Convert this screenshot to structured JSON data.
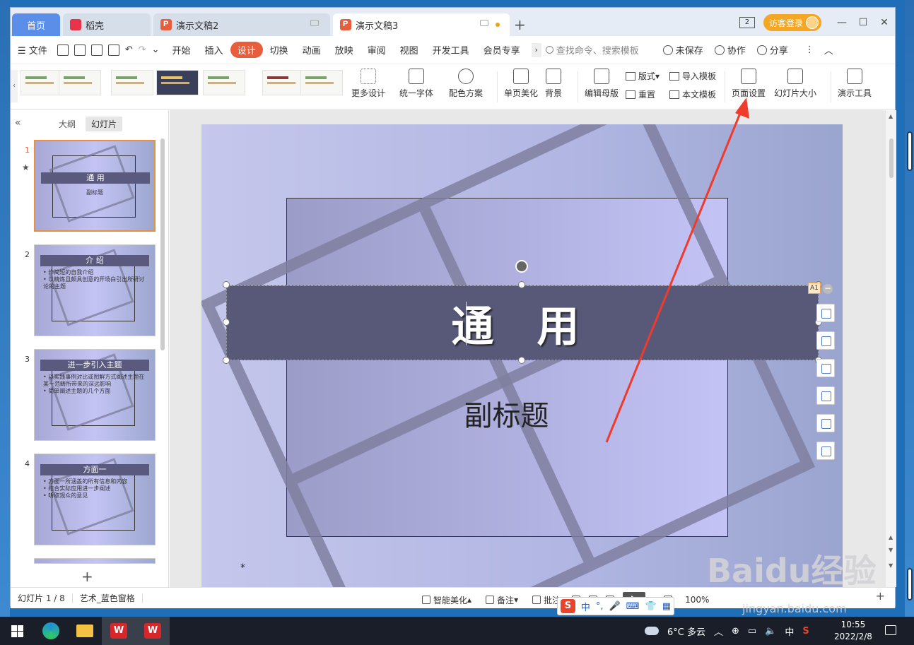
{
  "tabs": [
    {
      "label": "首页"
    },
    {
      "label": "稻壳"
    },
    {
      "label": "演示文稿2"
    },
    {
      "label": "演示文稿3"
    }
  ],
  "titlebar": {
    "badge": "2",
    "login": "访客登录"
  },
  "menu": {
    "file": "文件",
    "items": [
      "开始",
      "插入",
      "设计",
      "切换",
      "动画",
      "放映",
      "审阅",
      "视图",
      "开发工具",
      "会员专享"
    ],
    "active": "设计",
    "search_placeholder": "查找命令、搜索模板",
    "unsaved": "未保存",
    "collab": "协作",
    "share": "分享"
  },
  "ribbon": {
    "more_design": "更多设计",
    "unify_font": "统一字体",
    "color_scheme": "配色方案",
    "single_beautify": "单页美化",
    "background": "背景",
    "edit_master": "编辑母版",
    "layout": "版式",
    "reset": "重置",
    "import_template": "导入模板",
    "this_template": "本文模板",
    "page_setup": "页面设置",
    "slide_size": "幻灯片大小",
    "present_tools": "演示工具"
  },
  "leftpanel": {
    "tab_outline": "大纲",
    "tab_slides": "幻灯片",
    "slides": [
      {
        "num": "1",
        "title": "通 用",
        "lines": [
          "副标题"
        ]
      },
      {
        "num": "2",
        "title": "介 绍",
        "lines": [
          "• 作简短的自我介绍",
          "• 以精炼且颇具创意的开场白引出所研讨",
          "  论的主题"
        ]
      },
      {
        "num": "3",
        "title": "进一步引入主题",
        "lines": [
          "• 以实践事例对比或图解方式阐述主题在",
          "  某一范畴所带来的深远影响",
          "• 简单阐述主题的几个方面"
        ]
      },
      {
        "num": "4",
        "title": "方面一",
        "lines": [
          "• 方面一所涵盖的所有信息和内容",
          "• 结合实际应用进一步阐述",
          "• 听取观众的意见"
        ]
      }
    ]
  },
  "slide": {
    "title": "通 用",
    "subtitle": "副标题",
    "star": "*"
  },
  "floating": {
    "a1": "A1"
  },
  "statusbar": {
    "slide_count": "幻灯片 1 / 8",
    "theme": "艺术_蓝色窗格",
    "smart_beautify": "智能美化",
    "notes": "备注",
    "comments": "批注",
    "zoom": "100%"
  },
  "ime": {
    "mode": "中",
    "punct": "°,"
  },
  "watermark": {
    "brand": "Baidu经验",
    "url": "jingyan.baidu.com"
  },
  "taskbar": {
    "weather": "6°C 多云",
    "lang": "中",
    "time": "10:55",
    "date": "2022/2/8"
  },
  "colors": {
    "accent": "#e85e3d",
    "title_bar_bg": "#585879",
    "annotation_arrow": "#f03a2c"
  }
}
